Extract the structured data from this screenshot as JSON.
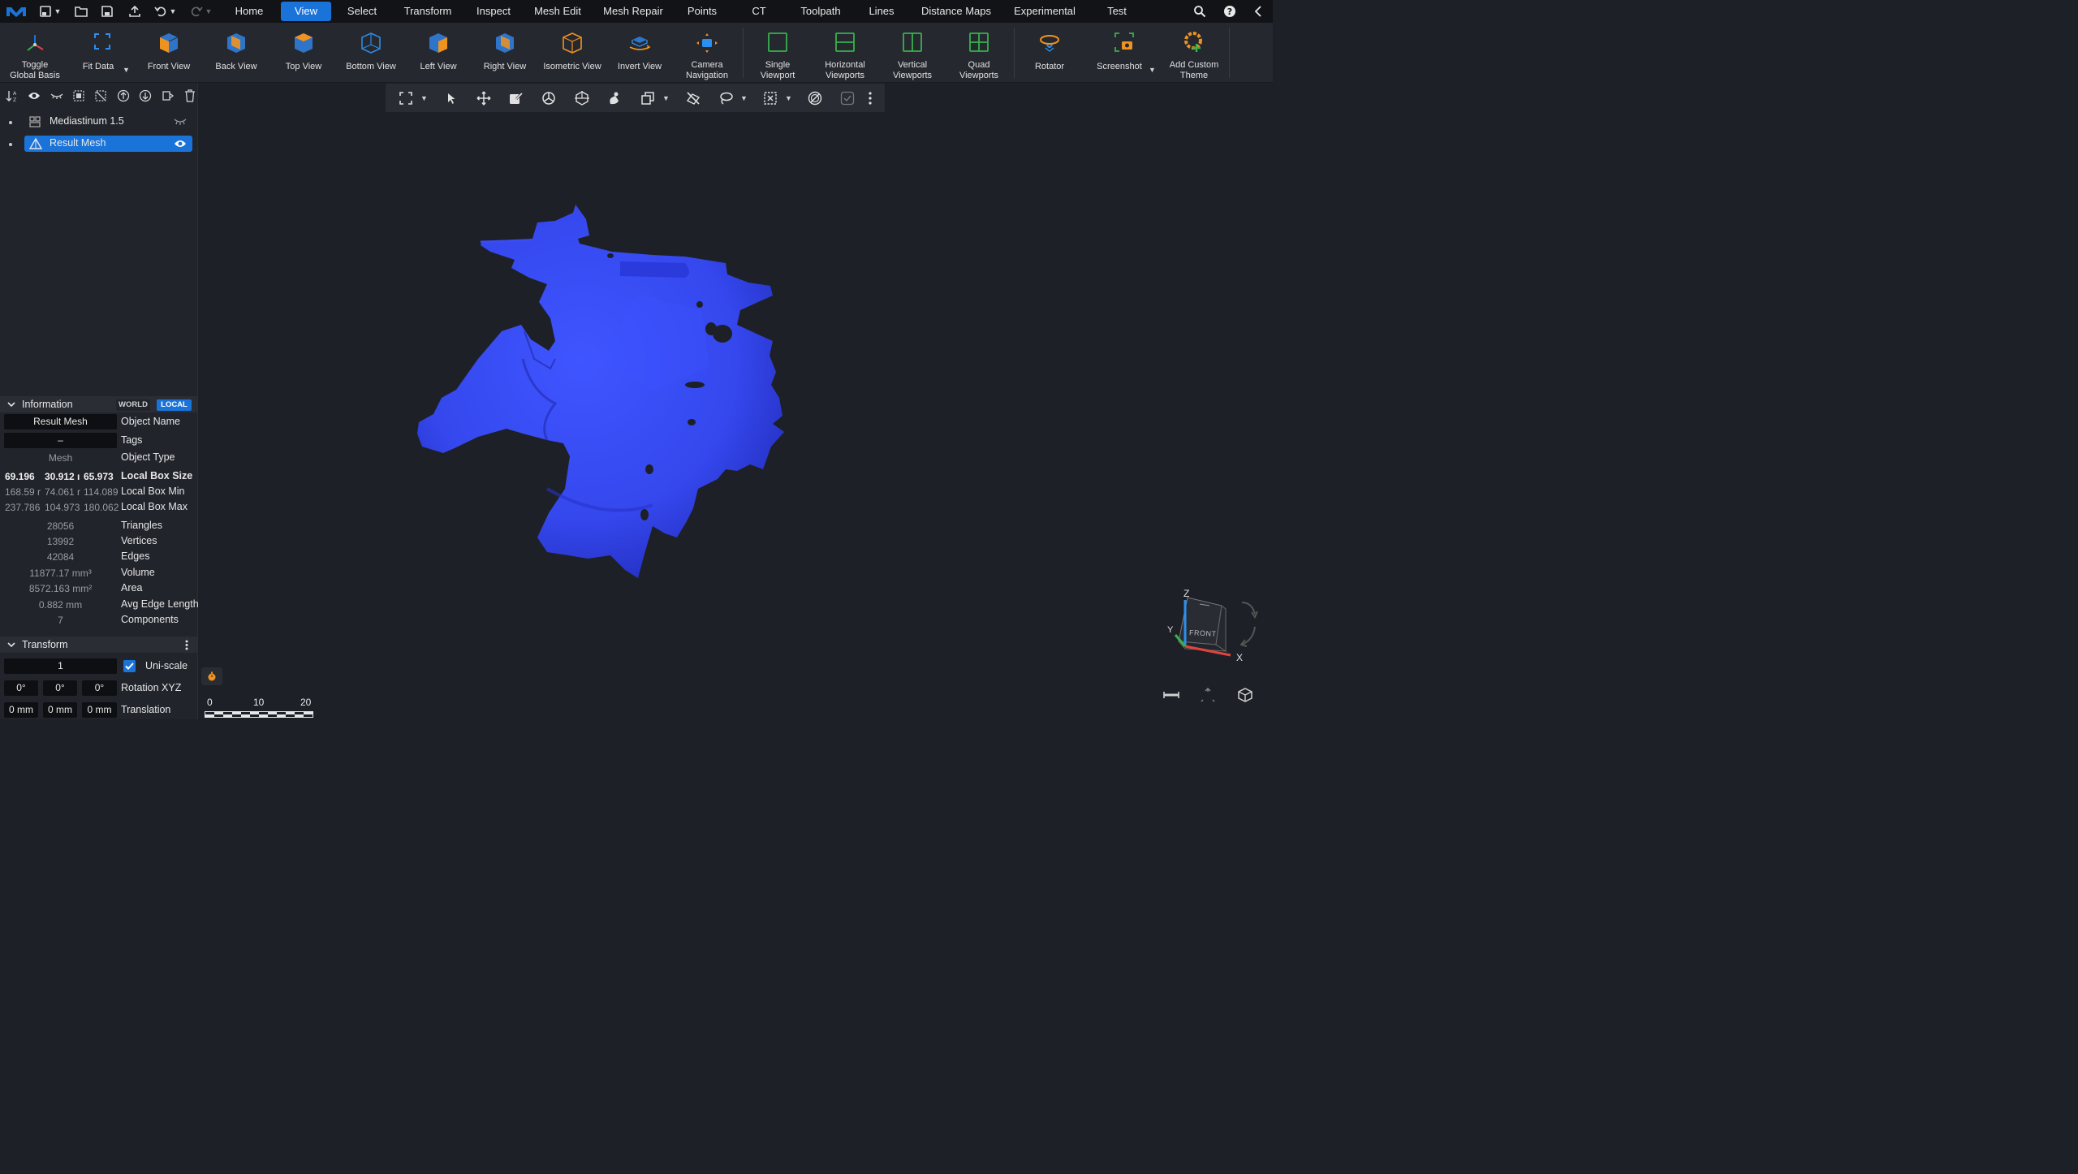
{
  "app": {
    "name": "MeshInspector"
  },
  "menu": {
    "tabs": [
      {
        "label": "Home",
        "active": false
      },
      {
        "label": "View",
        "active": true
      },
      {
        "label": "Select",
        "active": false
      },
      {
        "label": "Transform",
        "active": false
      },
      {
        "label": "Inspect",
        "active": false
      },
      {
        "label": "Mesh Edit",
        "active": false
      },
      {
        "label": "Mesh Repair",
        "active": false
      },
      {
        "label": "Points",
        "active": false
      },
      {
        "label": "CT",
        "active": false
      },
      {
        "label": "Toolpath",
        "active": false
      },
      {
        "label": "Lines",
        "active": false
      },
      {
        "label": "Distance Maps",
        "active": false
      },
      {
        "label": "Experimental",
        "active": false
      },
      {
        "label": "Test",
        "active": false
      }
    ]
  },
  "ribbon": {
    "buttons": [
      {
        "label": "Toggle\nGlobal Basis",
        "icon": "global-basis-icon"
      },
      {
        "label": "Fit Data",
        "icon": "fit-data-icon",
        "dropdown": true
      },
      {
        "label": "Front View",
        "icon": "front-view-cube-icon"
      },
      {
        "label": "Back View",
        "icon": "back-view-cube-icon"
      },
      {
        "label": "Top View",
        "icon": "top-view-cube-icon"
      },
      {
        "label": "Bottom View",
        "icon": "bottom-view-cube-icon"
      },
      {
        "label": "Left View",
        "icon": "left-view-cube-icon"
      },
      {
        "label": "Right View",
        "icon": "right-view-cube-icon"
      },
      {
        "label": "Isometric View",
        "icon": "isometric-view-cube-icon"
      },
      {
        "label": "Invert View",
        "icon": "invert-view-icon"
      },
      {
        "label": "Camera\nNavigation",
        "icon": "camera-navigation-icon"
      },
      {
        "label": "Single\nViewport",
        "icon": "single-viewport-icon"
      },
      {
        "label": "Horizontal\nViewports",
        "icon": "horizontal-viewports-icon"
      },
      {
        "label": "Vertical\nViewports",
        "icon": "vertical-viewports-icon"
      },
      {
        "label": "Quad\nViewports",
        "icon": "quad-viewports-icon"
      },
      {
        "label": "Rotator",
        "icon": "rotator-icon"
      },
      {
        "label": "Screenshot",
        "icon": "screenshot-icon",
        "dropdown": true
      },
      {
        "label": "Add Custom\nTheme",
        "icon": "add-custom-theme-icon"
      }
    ]
  },
  "scene": {
    "objects": [
      {
        "name": "Mediastinum 1.5",
        "visible": false,
        "selected": false,
        "icon": "mesh-object-icon"
      },
      {
        "name": "Result Mesh",
        "visible": true,
        "selected": true,
        "icon": "triangle-mesh-icon"
      }
    ]
  },
  "info": {
    "title": "Information",
    "mode_world": "WORLD",
    "mode_local": "LOCAL",
    "active_mode": "LOCAL",
    "object_name": "Result Mesh",
    "object_name_label": "Object Name",
    "tags": "–",
    "tags_label": "Tags",
    "object_type": "Mesh",
    "object_type_label": "Object Type",
    "box_size": [
      "69.196",
      "30.912 ı",
      "65.973"
    ],
    "box_size_label": "Local Box Size",
    "box_min": [
      "168.59 r",
      "74.061 r",
      "114.089"
    ],
    "box_min_label": "Local Box Min",
    "box_max": [
      "237.786",
      "104.973",
      "180.062"
    ],
    "box_max_label": "Local Box Max",
    "stats": [
      {
        "value": "28056",
        "label": "Triangles"
      },
      {
        "value": "13992",
        "label": "Vertices"
      },
      {
        "value": "42084",
        "label": "Edges"
      },
      {
        "value": "11877.17 mm³",
        "label": "Volume"
      },
      {
        "value": "8572.163 mm²",
        "label": "Area"
      },
      {
        "value": "0.882 mm",
        "label": "Avg Edge Length"
      },
      {
        "value": "7",
        "label": "Components"
      }
    ]
  },
  "transform": {
    "title": "Transform",
    "scale": "1",
    "uniscale_label": "Uni-scale",
    "uniscale_checked": true,
    "rotation": [
      "0°",
      "0°",
      "0°"
    ],
    "rotation_label": "Rotation XYZ",
    "translation": [
      "0 mm",
      "0 mm",
      "0 mm"
    ],
    "translation_label": "Translation"
  },
  "viewport": {
    "scale_bar": [
      "0",
      "10",
      "20"
    ],
    "cube_face": "FRONT",
    "axes": {
      "x": "X",
      "y": "Y",
      "z": "Z"
    }
  },
  "colors": {
    "accent": "#1a73d9",
    "mesh": "#3a4df0",
    "orange": "#f0931e",
    "green": "#37b24a",
    "background": "#1e2027"
  }
}
